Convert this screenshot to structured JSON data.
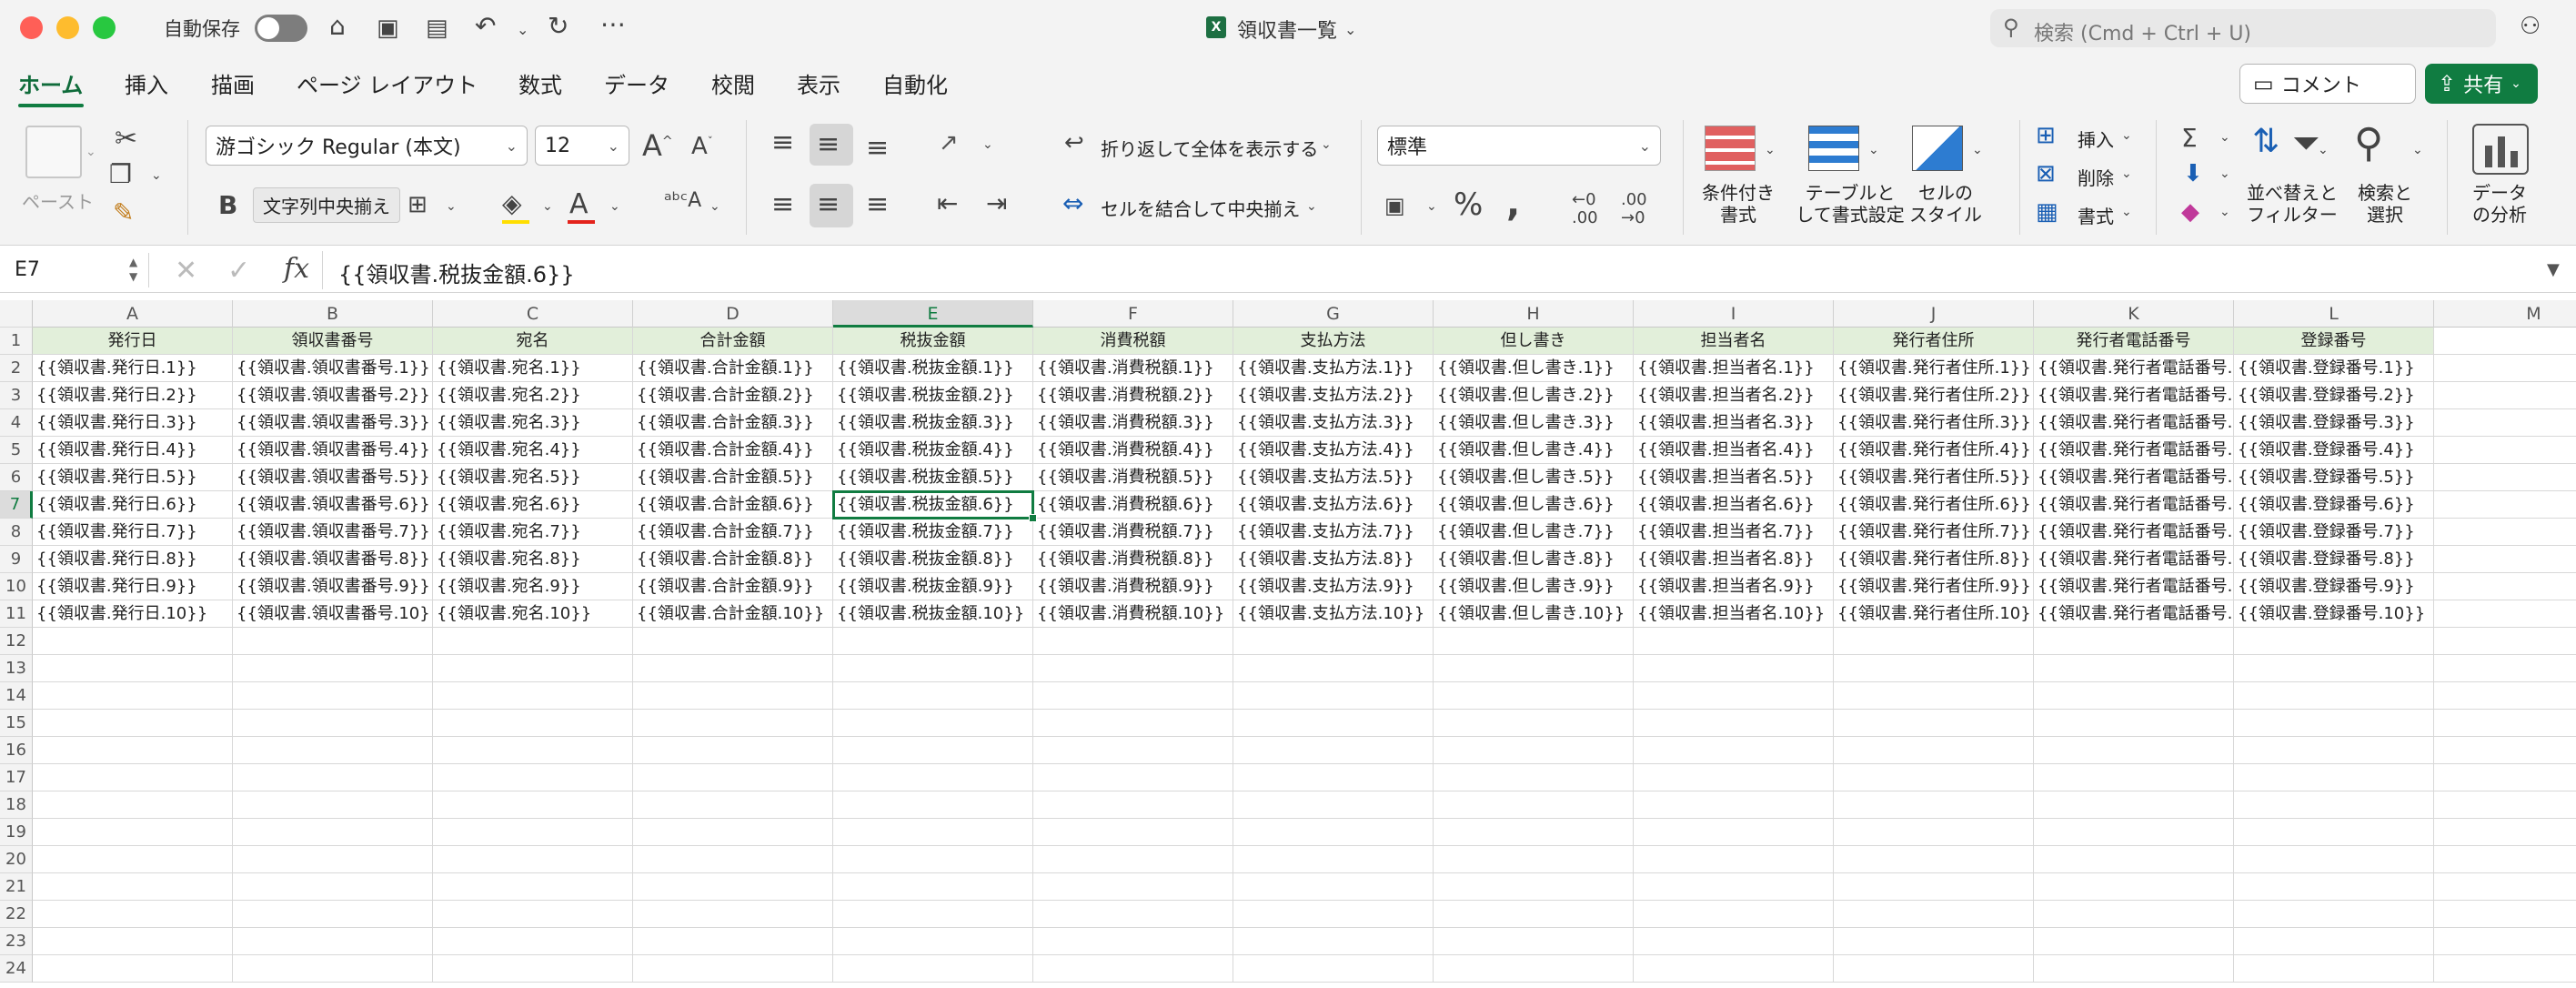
{
  "window": {
    "autosave_label": "自動保存",
    "doc_title": "領収書一覧",
    "search_placeholder": "検索 (Cmd + Ctrl + U)"
  },
  "tabs": [
    "ホーム",
    "挿入",
    "描画",
    "ページ レイアウト",
    "数式",
    "データ",
    "校閲",
    "表示",
    "自動化"
  ],
  "header_buttons": {
    "comment": "コメント",
    "share": "共有"
  },
  "ribbon": {
    "paste_label": "ペースト",
    "font_name": "游ゴシック Regular (本文)",
    "font_size": "12",
    "bold_label": "B",
    "tooltip": "文字列中央揃え",
    "wrap_text": "折り返して全体を表示する",
    "merge_center": "セルを結合して中央揃え",
    "number_format": "標準",
    "conditional_format": [
      "条件付き",
      "書式"
    ],
    "table_format": [
      "テーブルと",
      "して書式設定"
    ],
    "cell_styles": [
      "セルの",
      "スタイル"
    ],
    "insert": "挿入",
    "delete": "削除",
    "format": "書式",
    "sort_filter": [
      "並べ替えと",
      "フィルター"
    ],
    "find_select": [
      "検索と",
      "選択"
    ],
    "analyze_data": [
      "データ",
      "の分析"
    ]
  },
  "formula_bar": {
    "name_box": "E7",
    "fx": "fx",
    "formula": "{{領収書.税抜金額.6}}"
  },
  "sheet": {
    "columns": [
      "A",
      "B",
      "C",
      "D",
      "E",
      "F",
      "G",
      "H",
      "I",
      "J",
      "K",
      "L",
      "M"
    ],
    "selected_column": "E",
    "selected_row": 7,
    "headers": [
      "発行日",
      "領収書番号",
      "宛名",
      "合計金額",
      "税抜金額",
      "消費税額",
      "支払方法",
      "但し書き",
      "担当者名",
      "発行者住所",
      "発行者電話番号",
      "登録番号"
    ],
    "field_keys": [
      "発行日",
      "領収書番号",
      "宛名",
      "合計金額",
      "税抜金額",
      "消費税額",
      "支払方法",
      "但し書き",
      "担当者名",
      "発行者住所",
      "発行者電話番号",
      "登録番号"
    ],
    "row_count": 24,
    "data_rows": 10
  },
  "colors": {
    "accent": "#107c41",
    "header_fill": "#e2efda",
    "share_btn": "#107c41"
  }
}
